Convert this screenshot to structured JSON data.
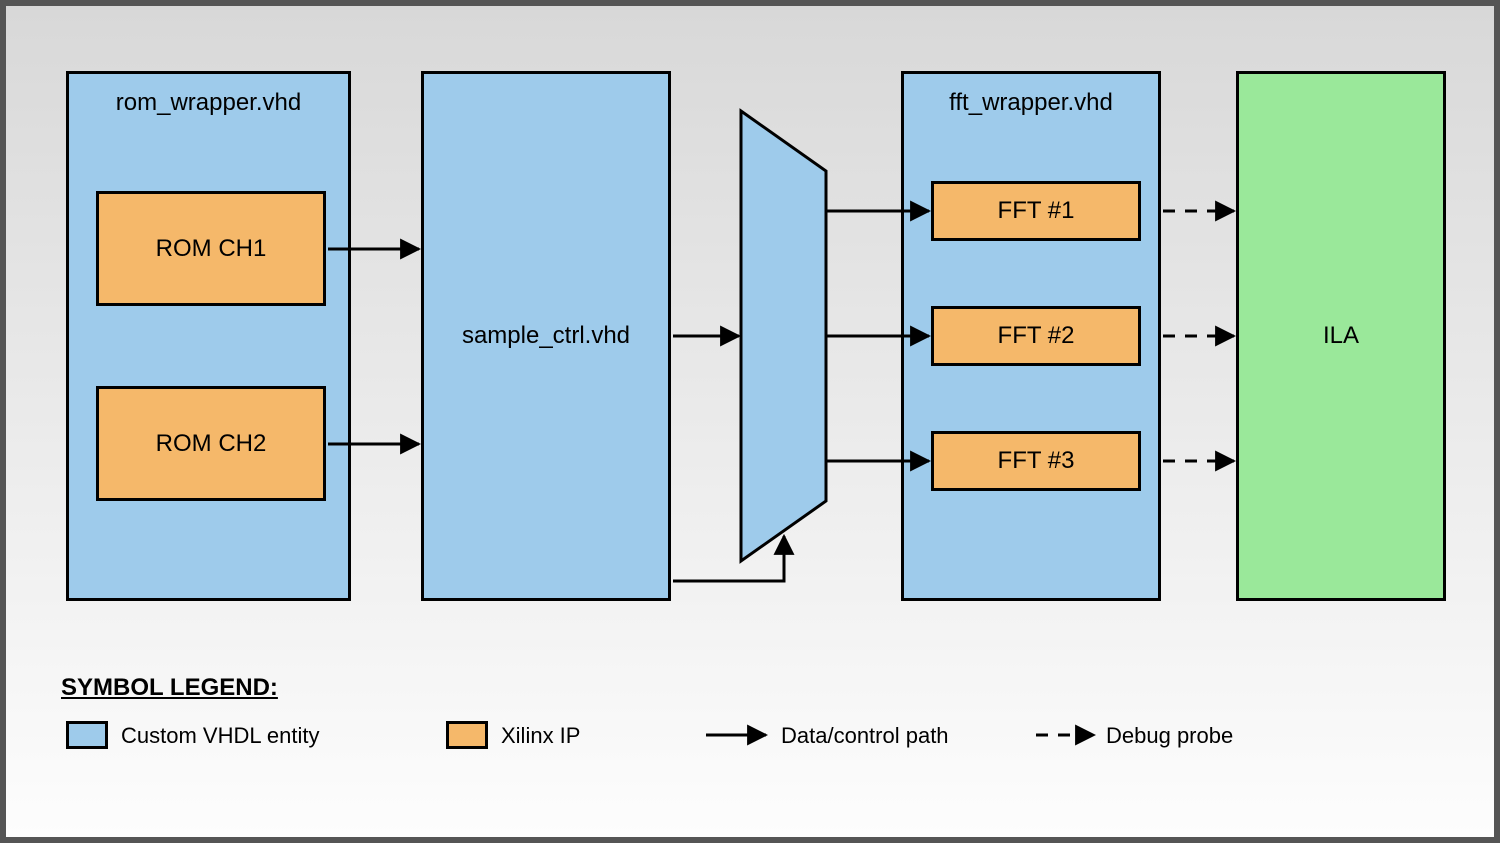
{
  "blocks": {
    "rom_wrapper": {
      "title": "rom_wrapper.vhd"
    },
    "rom_ch1": {
      "label": "ROM CH1"
    },
    "rom_ch2": {
      "label": "ROM CH2"
    },
    "sample_ctrl": {
      "title": "sample_ctrl.vhd"
    },
    "fft_wrapper": {
      "title": "fft_wrapper.vhd"
    },
    "fft1": {
      "label": "FFT #1"
    },
    "fft2": {
      "label": "FFT #2"
    },
    "fft3": {
      "label": "FFT #3"
    },
    "ila": {
      "label": "ILA"
    }
  },
  "legend": {
    "title": "SYMBOL LEGEND:",
    "items": {
      "custom": "Custom VHDL entity",
      "xilinx": "Xilinx IP",
      "datapath": "Data/control path",
      "debug": "Debug probe"
    }
  },
  "colors": {
    "blue": "#9ecbeb",
    "orange": "#f5b86a",
    "green": "#9ae89a",
    "stroke": "#000000"
  }
}
